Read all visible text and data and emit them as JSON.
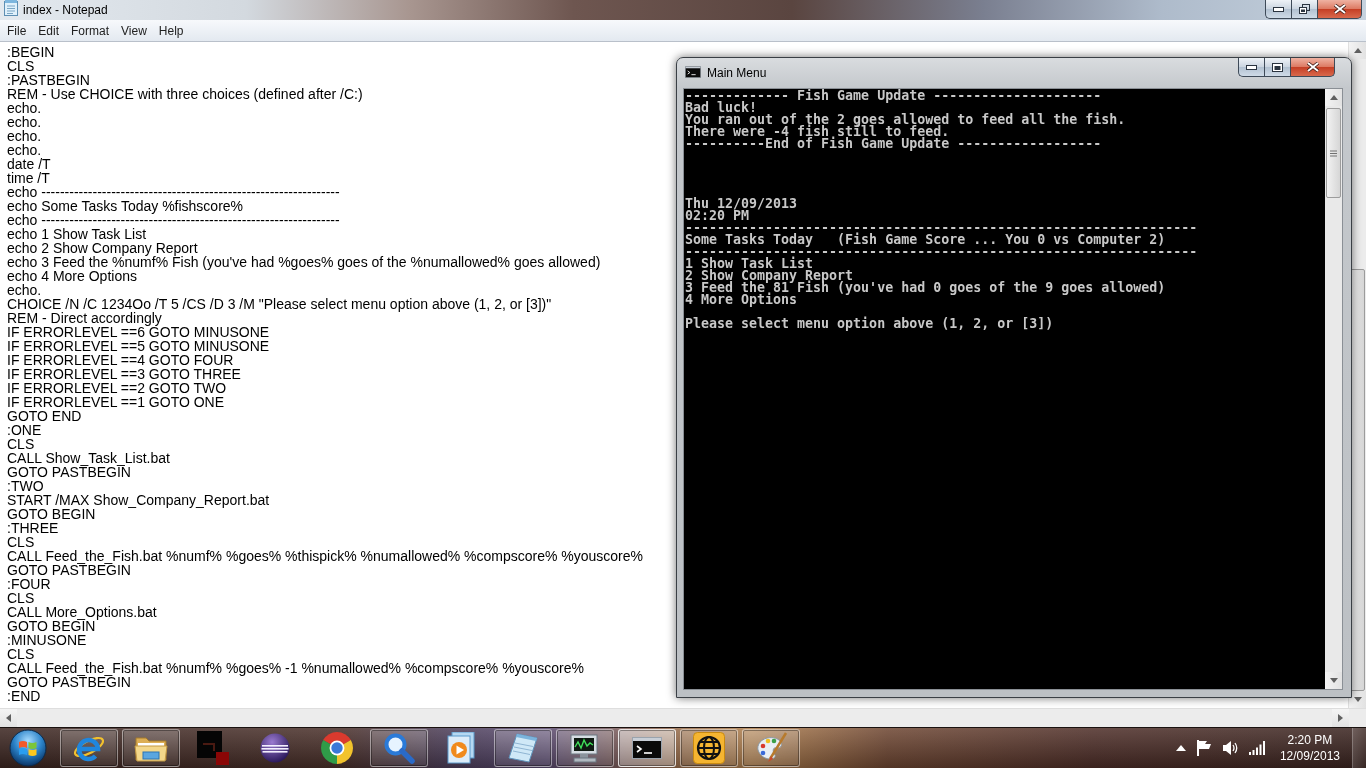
{
  "notepad": {
    "title": "index - Notepad",
    "menu": [
      "File",
      "Edit",
      "Format",
      "View",
      "Help"
    ],
    "lines": [
      ":BEGIN",
      "CLS",
      ":PASTBEGIN",
      "REM - Use CHOICE with three choices (defined after /C:)",
      "echo.",
      "echo.",
      "echo.",
      "echo.",
      "date /T",
      "time /T",
      "echo ----------------------------------------------------------------",
      "echo Some Tasks Today %fishscore%",
      "echo ----------------------------------------------------------------",
      "echo 1 Show Task List",
      "echo 2 Show Company Report",
      "echo 3 Feed the %numf% Fish (you've had %goes% goes of the %numallowed% goes allowed)",
      "echo 4 More Options",
      "echo.",
      "CHOICE /N /C 1234Oo /T 5 /CS /D 3 /M \"Please select menu option above (1, 2, or [3])\"",
      "REM - Direct accordingly",
      "IF ERRORLEVEL ==6 GOTO MINUSONE",
      "IF ERRORLEVEL ==5 GOTO MINUSONE",
      "IF ERRORLEVEL ==4 GOTO FOUR",
      "IF ERRORLEVEL ==3 GOTO THREE",
      "IF ERRORLEVEL ==2 GOTO TWO",
      "IF ERRORLEVEL ==1 GOTO ONE",
      "GOTO END",
      ":ONE",
      "CLS",
      "CALL Show_Task_List.bat",
      "GOTO PASTBEGIN",
      ":TWO",
      "START /MAX Show_Company_Report.bat",
      "GOTO BEGIN",
      ":THREE",
      "CLS",
      "CALL Feed_the_Fish.bat %numf% %goes% %thispick% %numallowed% %compscore% %youscore%",
      "GOTO PASTBEGIN",
      ":FOUR",
      "CLS",
      "CALL More_Options.bat",
      "GOTO BEGIN",
      ":MINUSONE",
      "CLS",
      "CALL Feed_the_Fish.bat %numf% %goes% -1 %numallowed% %compscore% %youscore%",
      "GOTO PASTBEGIN",
      ":END"
    ]
  },
  "console": {
    "title": "Main Menu",
    "lines": [
      {
        "kind": "text",
        "text": "------------- Fish Game Update ---------------------"
      },
      {
        "kind": "text",
        "text": "Bad luck!"
      },
      {
        "kind": "text",
        "text": "You ran out of the 2 goes allowed to feed all the fish."
      },
      {
        "kind": "text",
        "text": "There were -4 fish still to feed."
      },
      {
        "kind": "text",
        "text": "----------End of Fish Game Update ------------------"
      },
      {
        "kind": "blank"
      },
      {
        "kind": "blank"
      },
      {
        "kind": "blank"
      },
      {
        "kind": "blank"
      },
      {
        "kind": "text",
        "text": "Thu 12/09/2013"
      },
      {
        "kind": "text",
        "text": "02:20 PM"
      },
      {
        "kind": "text",
        "text": "----------------------------------------------------------------"
      },
      {
        "kind": "text",
        "text": "Some Tasks Today   (Fish Game Score ... You 0 vs Computer 2)"
      },
      {
        "kind": "text",
        "text": "----------------------------------------------------------------"
      },
      {
        "kind": "text",
        "text": "1 Show Task List"
      },
      {
        "kind": "text",
        "text": "2 Show Company Report"
      },
      {
        "kind": "text",
        "text": "3 Feed the 81 Fish (you've had 0 goes of the 9 goes allowed)"
      },
      {
        "kind": "text",
        "text": "4 More Options"
      },
      {
        "kind": "blank"
      },
      {
        "kind": "text",
        "text": "Please select menu option above (1, 2, or [3])"
      }
    ]
  },
  "taskbar": {
    "buttons": [
      {
        "running": true,
        "selected": false
      },
      {
        "running": true,
        "selected": false
      },
      {
        "running": false,
        "selected": false
      },
      {
        "running": false,
        "selected": false
      },
      {
        "running": false,
        "selected": false
      },
      {
        "running": true,
        "selected": false
      },
      {
        "running": false,
        "selected": false
      },
      {
        "running": true,
        "selected": false
      },
      {
        "running": true,
        "selected": false
      },
      {
        "running": true,
        "selected": true
      },
      {
        "running": true,
        "selected": false
      },
      {
        "running": true,
        "selected": false
      }
    ],
    "clock": {
      "time": "2:20 PM",
      "date": "12/09/2013"
    }
  }
}
